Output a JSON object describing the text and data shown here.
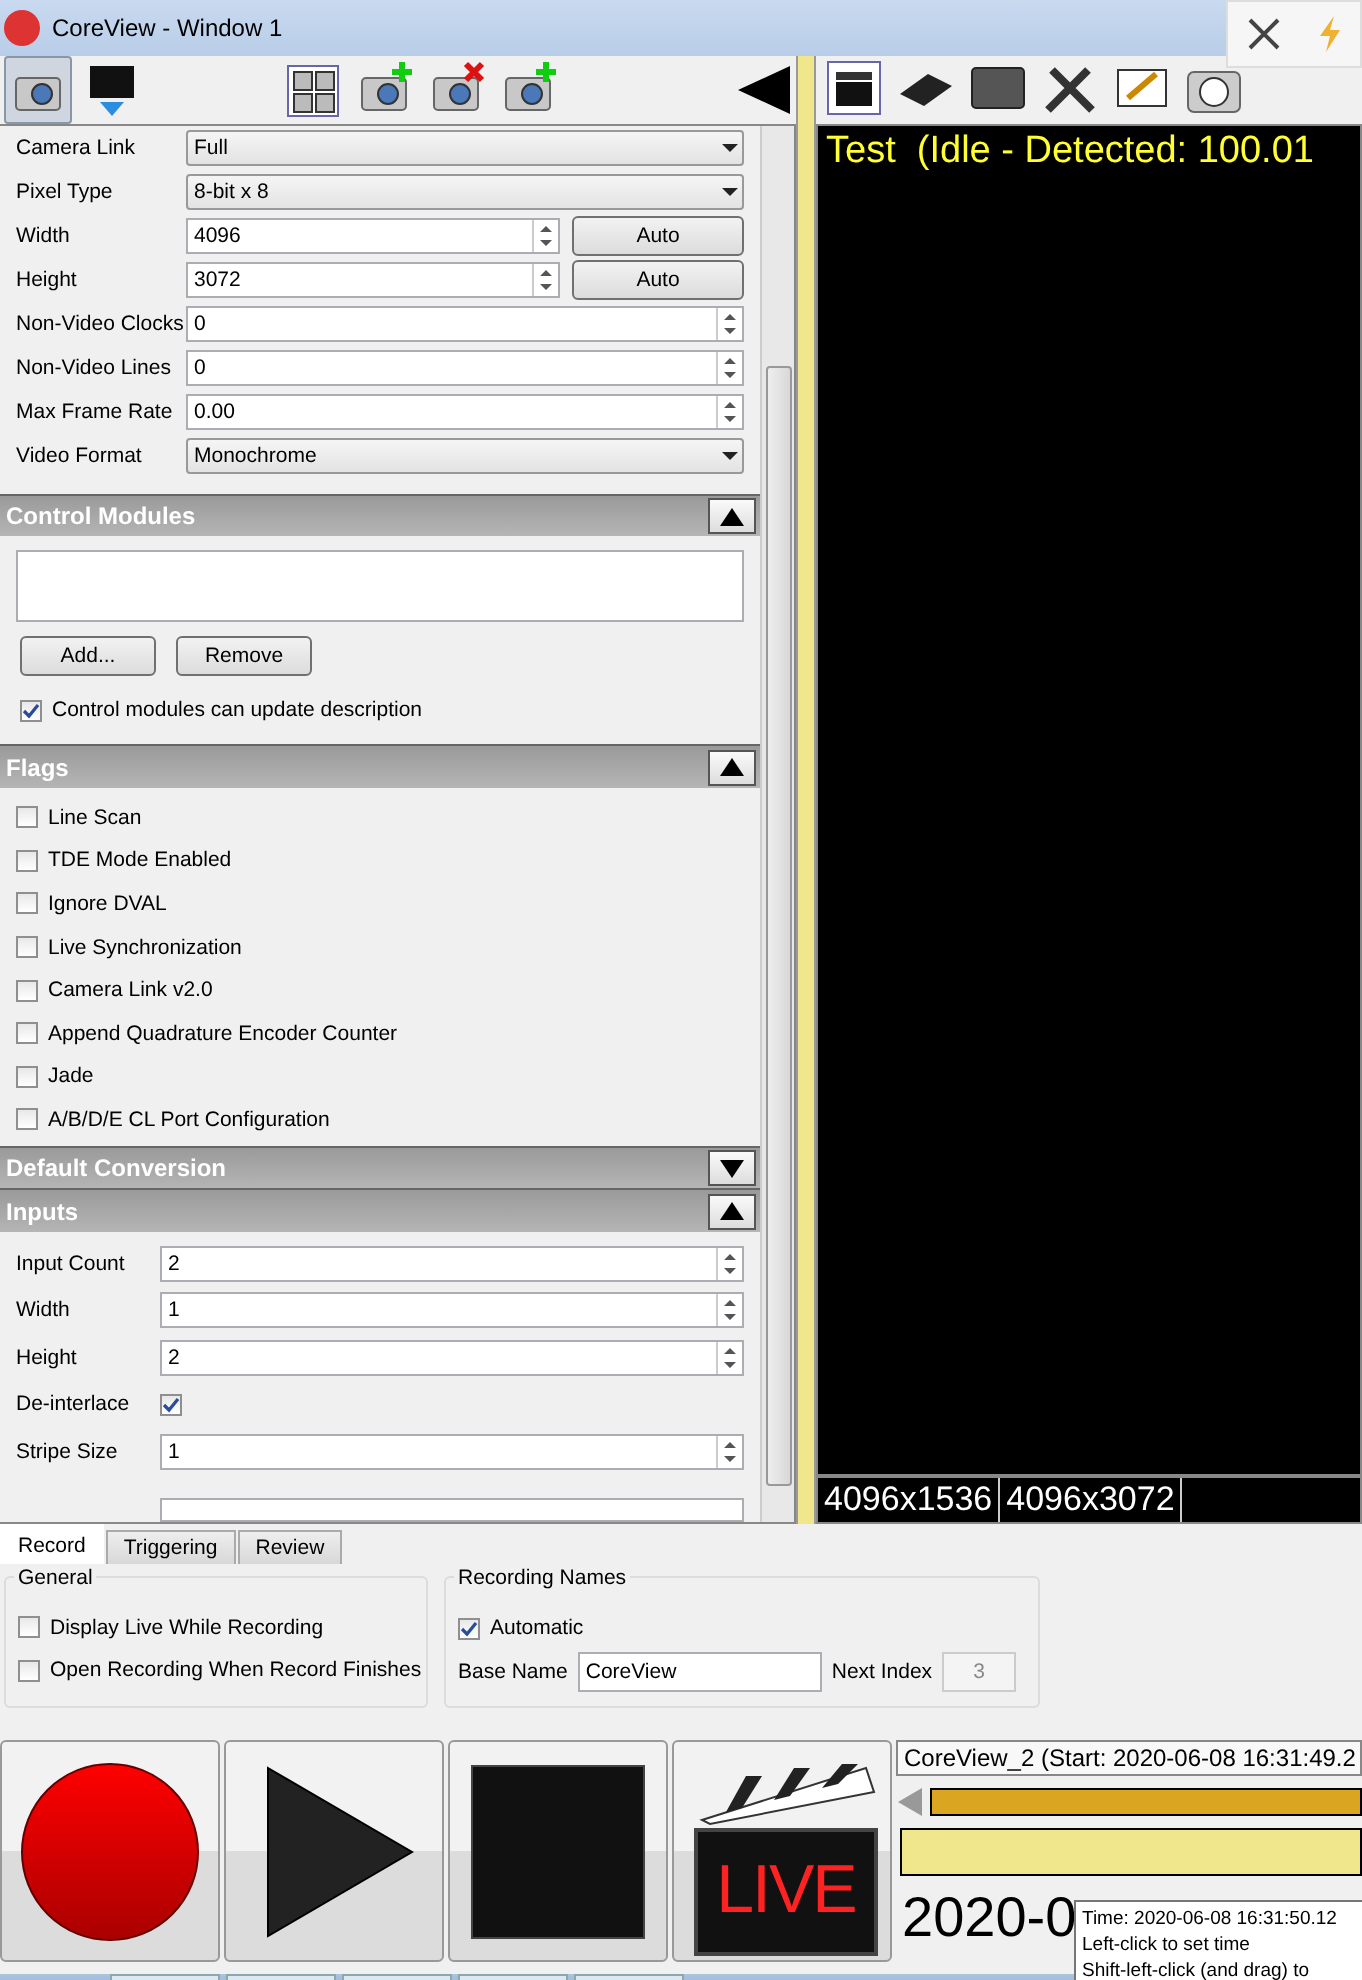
{
  "window": {
    "title": "CoreView - Window 1"
  },
  "settings": [
    {
      "label": "Camera Link",
      "kind": "dropdown",
      "value": "Full"
    },
    {
      "label": "Pixel Type",
      "kind": "dropdown",
      "value": "8-bit x 8"
    },
    {
      "label": "Width",
      "kind": "spin",
      "value": "4096",
      "button": "Auto"
    },
    {
      "label": "Height",
      "kind": "spin",
      "value": "3072",
      "button": "Auto"
    },
    {
      "label": "Non-Video Clocks",
      "kind": "spin",
      "value": "0"
    },
    {
      "label": "Non-Video Lines",
      "kind": "spin",
      "value": "0"
    },
    {
      "label": "Max Frame Rate",
      "kind": "spin",
      "value": "0.00"
    },
    {
      "label": "Video Format",
      "kind": "dropdown",
      "value": "Monochrome"
    }
  ],
  "control_modules": {
    "title": "Control Modules",
    "expanded": true,
    "buttons": [
      "Add...",
      "Remove"
    ],
    "option": {
      "label": "Control modules can update description",
      "checked": true
    }
  },
  "flags": {
    "title": "Flags",
    "expanded": true,
    "items": [
      {
        "label": "Line Scan",
        "checked": false
      },
      {
        "label": "TDE Mode Enabled",
        "checked": false
      },
      {
        "label": "Ignore DVAL",
        "checked": false
      },
      {
        "label": "Live Synchronization",
        "checked": false
      },
      {
        "label": "Camera Link v2.0",
        "checked": false
      },
      {
        "label": "Append Quadrature Encoder Counter",
        "checked": false
      },
      {
        "label": "Jade",
        "checked": false
      },
      {
        "label": "A/B/D/E CL Port Configuration",
        "checked": false
      }
    ]
  },
  "default_conversion": {
    "title": "Default Conversion",
    "expanded": false
  },
  "inputs": {
    "title": "Inputs",
    "expanded": true,
    "fields": [
      {
        "label": "Input Count",
        "kind": "spin",
        "value": "2"
      },
      {
        "label": "Width",
        "kind": "spin",
        "value": "1"
      },
      {
        "label": "Height",
        "kind": "spin",
        "value": "2"
      },
      {
        "label": "De-interlace",
        "kind": "checkbox",
        "checked": true
      },
      {
        "label": "Stripe Size",
        "kind": "spin",
        "value": "1"
      }
    ]
  },
  "viewer": {
    "title": "Test  (Idle - Detected: 100.01",
    "sizes": [
      "4096x1536",
      "4096x3072"
    ]
  },
  "tabs": [
    {
      "label": "Record",
      "selected": true
    },
    {
      "label": "Triggering",
      "selected": false
    },
    {
      "label": "Review",
      "selected": false
    }
  ],
  "general": {
    "title": "General",
    "items": [
      {
        "label": "Display Live While Recording",
        "checked": false
      },
      {
        "label": "Open Recording When Record Finishes",
        "checked": false
      }
    ]
  },
  "recording_names": {
    "title": "Recording Names",
    "automatic": {
      "label": "Automatic",
      "checked": true
    },
    "base_name_label": "Base Name",
    "base_name": "CoreView",
    "next_index_label": "Next Index",
    "next_index": "3",
    "next_index_disabled": true
  },
  "live_label": "LIVE",
  "timeline": {
    "recording": "CoreView_2 (Start: 2020-06-08 16:31:49.2",
    "date": "2020-0"
  },
  "tooltip": {
    "lines": [
      "Time: 2020-06-08 16:31:50.12",
      "Left-click to set time",
      "Shift-left-click (and drag) to"
    ]
  }
}
